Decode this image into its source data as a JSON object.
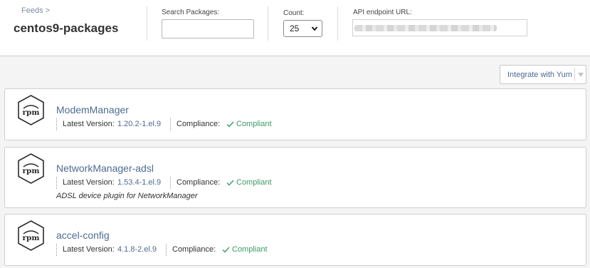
{
  "header": {
    "breadcrumb": "Feeds >",
    "feed_name": "centos9-packages",
    "search_label": "Search Packages:",
    "search_value": "",
    "count_label": "Count:",
    "count_value": "25",
    "api_label": "API endpoint URL:"
  },
  "toolbar": {
    "integrate_label": "Integrate with Yum"
  },
  "labels": {
    "latest_version": "Latest Version:",
    "compliance": "Compliance:"
  },
  "packages": [
    {
      "name": "ModemManager",
      "version": "1.20.2-1.el.9",
      "status": "Compliant",
      "description": ""
    },
    {
      "name": "NetworkManager-adsl",
      "version": "1.53.4-1.el.9",
      "status": "Compliant",
      "description": "ADSL device plugin for NetworkManager"
    },
    {
      "name": "accel-config",
      "version": "4.1.8-2.el.9",
      "status": "Compliant",
      "description": ""
    }
  ],
  "icons": {
    "package": "rpm-icon",
    "compliant": "check-icon",
    "dropdown": "chevron-down-icon"
  },
  "colors": {
    "link": "#4e6b91",
    "compliant": "#3b9a63"
  }
}
